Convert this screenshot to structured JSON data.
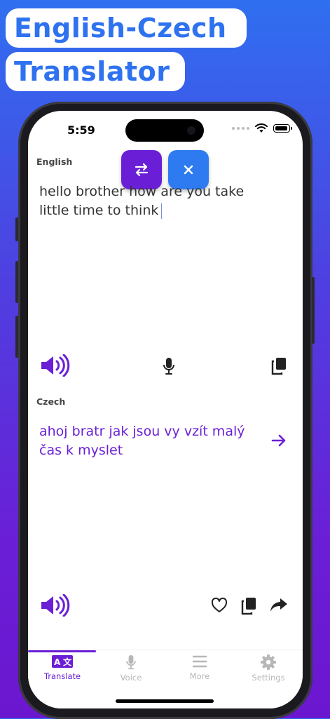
{
  "banner": {
    "line1": "English-Czech",
    "line2": "Translator"
  },
  "status": {
    "time": "5:59"
  },
  "source": {
    "language": "English",
    "text": "hello brother how are you take little time to think"
  },
  "target": {
    "language": "Czech",
    "text": "ahoj bratr jak jsou vy vzít malý čas k myslet"
  },
  "actions": {
    "swap_icon": "swap-arrows-icon",
    "clear_icon": "close-icon",
    "speaker_icon": "speaker-icon",
    "mic_icon": "microphone-icon",
    "copy_icon": "copy-icon",
    "arrow_icon": "arrow-right-icon",
    "heart_icon": "heart-icon",
    "share_icon": "share-icon"
  },
  "tabs": [
    {
      "label": "Translate",
      "icon": "translate-icon",
      "active": true
    },
    {
      "label": "Voice",
      "icon": "microphone-icon",
      "active": false
    },
    {
      "label": "More",
      "icon": "menu-icon",
      "active": false
    },
    {
      "label": "Settings",
      "icon": "gear-icon",
      "active": false
    }
  ],
  "colors": {
    "accent": "#6a1fd6",
    "blue": "#2e7bf1",
    "inactive": "#b7b7b7"
  }
}
